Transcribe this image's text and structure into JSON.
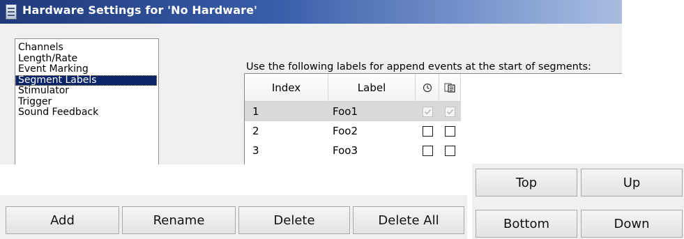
{
  "window": {
    "title": "Hardware Settings for 'No Hardware'"
  },
  "categories": [
    {
      "label": "Channels"
    },
    {
      "label": "Length/Rate"
    },
    {
      "label": "Event Marking"
    },
    {
      "label": "Segment Labels",
      "selected": true
    },
    {
      "label": "Stimulator"
    },
    {
      "label": "Trigger"
    },
    {
      "label": "Sound Feedback"
    }
  ],
  "segment_labels": {
    "instruction": "Use the following labels for append events at the start of segments:",
    "columns": {
      "index": "Index",
      "label": "Label",
      "col3_icon": "clock-icon",
      "col4_icon": "copy-label-icon"
    },
    "rows": [
      {
        "index": "1",
        "label": "Foo1",
        "chk1": true,
        "chk2": true,
        "selected": true
      },
      {
        "index": "2",
        "label": "Foo2",
        "chk1": false,
        "chk2": false
      },
      {
        "index": "3",
        "label": "Foo3",
        "chk1": false,
        "chk2": false
      }
    ]
  },
  "buttons": {
    "add": "Add",
    "rename": "Rename",
    "delete": "Delete",
    "delete_all": "Delete All",
    "top": "Top",
    "up": "Up",
    "bottom": "Bottom",
    "down": "Down"
  }
}
